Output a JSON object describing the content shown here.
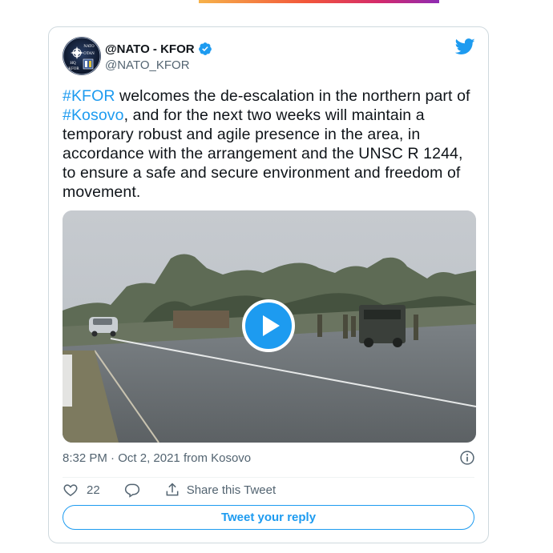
{
  "tweet": {
    "display_name": "@NATO - KFOR",
    "handle": "@NATO_KFOR",
    "avatar_text": [
      "NATO",
      "OTAN",
      "HQ",
      "KFOR"
    ],
    "text_parts": [
      {
        "text": "#KFOR",
        "type": "hashtag"
      },
      {
        "text": " welcomes the de-escalation in the northern part of ",
        "type": "text"
      },
      {
        "text": "#Kosovo",
        "type": "hashtag"
      },
      {
        "text": ", and for the next two weeks will maintain a temporary robust and agile presence in the area, in accordance with the arrangement and the UNSC R 1244, to ensure a safe and secure environment and freedom of movement.",
        "type": "text"
      }
    ],
    "time": "8:32 PM",
    "separator": " · ",
    "date": "Oct 2, 2021",
    "location": " from Kosovo",
    "likes": "22",
    "share_label": "Share this Tweet",
    "reply_label": "Tweet your reply"
  },
  "icons": {
    "verified": "verified-badge-icon",
    "bird": "twitter-bird-icon",
    "play": "play-icon",
    "info": "info-icon",
    "like": "heart-icon",
    "reply": "speech-bubble-icon",
    "share": "share-upload-icon"
  },
  "colors": {
    "accent": "#1d9bf0",
    "text": "#0f1419",
    "secondary": "#536471",
    "border": "#cfd9de"
  }
}
